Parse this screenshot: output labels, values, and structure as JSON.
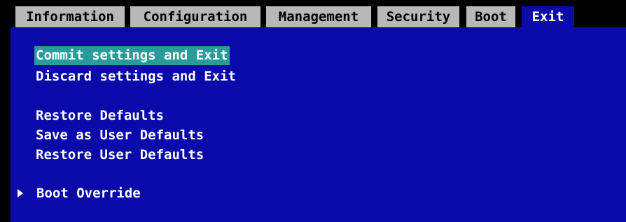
{
  "tabs": [
    {
      "label": "Information"
    },
    {
      "label": "Configuration"
    },
    {
      "label": "Management"
    },
    {
      "label": "Security"
    },
    {
      "label": "Boot"
    },
    {
      "label": "Exit",
      "active": true
    }
  ],
  "menu": {
    "commit_exit": "Commit settings and Exit",
    "discard_exit": "Discard settings and Exit",
    "restore_defaults": "Restore Defaults",
    "save_user_defaults": "Save as User Defaults",
    "restore_user_defaults": "Restore User Defaults",
    "boot_override": "Boot Override"
  },
  "colors": {
    "panel": "#0a0aa8",
    "tab_inactive": "#b8b8b8",
    "selection": "#2b9a9a",
    "text": "#ffffff"
  },
  "icons": {
    "submenu": "triangle-right"
  }
}
